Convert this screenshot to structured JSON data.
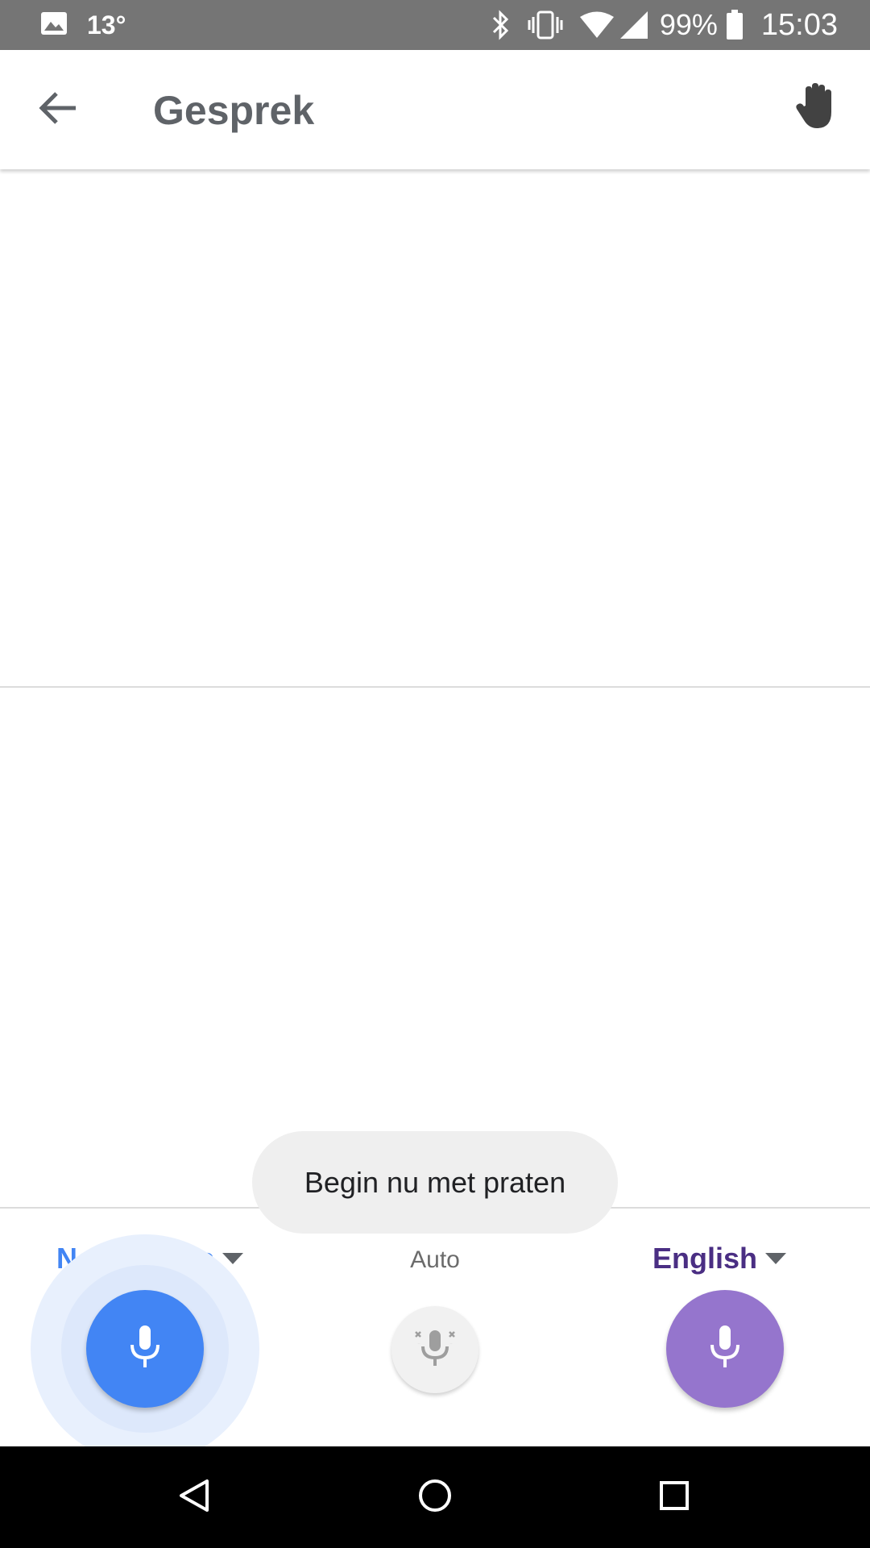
{
  "status_bar": {
    "temperature": "13°",
    "battery_percent": "99%",
    "time": "15:03",
    "icons": [
      "image-icon",
      "bluetooth-icon",
      "vibrate-icon",
      "wifi-icon",
      "signal-icon",
      "battery-icon"
    ]
  },
  "header": {
    "title": "Gesprek",
    "back_icon": "arrow-back-icon",
    "action_icon": "hand-icon"
  },
  "toast": {
    "text": "Begin nu met praten"
  },
  "languages": {
    "left": {
      "label": "Nederlands",
      "color": "#4285f4",
      "state": "listening"
    },
    "auto": {
      "label": "Auto"
    },
    "right": {
      "label": "English",
      "color": "#4a2e83",
      "button_color": "#9575cd"
    }
  },
  "nav_bar": {
    "icons": [
      "back-triangle-icon",
      "home-circle-icon",
      "recents-square-icon"
    ]
  }
}
